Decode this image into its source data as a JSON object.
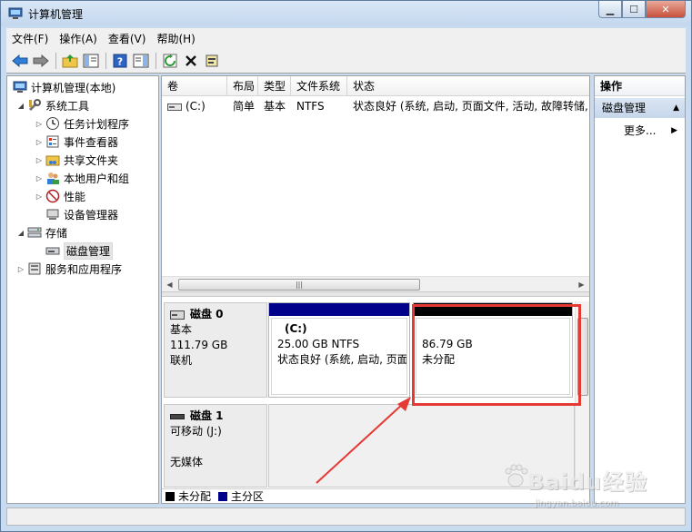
{
  "window": {
    "title": "计算机管理"
  },
  "menu": [
    "文件(F)",
    "操作(A)",
    "查看(V)",
    "帮助(H)"
  ],
  "toolbar": [
    "back-icon",
    "forward-icon",
    "up-folder-icon",
    "show-tree-icon",
    "help-icon",
    "show-action-pane-icon",
    "refresh-icon",
    "delete-icon",
    "properties-icon"
  ],
  "tree": {
    "root": "计算机管理(本地)",
    "system_tools": "系统工具",
    "task_scheduler": "任务计划程序",
    "event_viewer": "事件查看器",
    "shared_folders": "共享文件夹",
    "local_users": "本地用户和组",
    "performance": "性能",
    "device_manager": "设备管理器",
    "storage": "存储",
    "disk_management": "磁盘管理",
    "services_apps": "服务和应用程序"
  },
  "volume_list": {
    "columns": [
      "卷",
      "布局",
      "类型",
      "文件系统",
      "状态"
    ],
    "rows": [
      {
        "volume": "(C:)",
        "layout": "简单",
        "type": "基本",
        "fs": "NTFS",
        "status": "状态良好 (系统, 启动, 页面文件, 活动, 故障转储, 主"
      }
    ]
  },
  "disks": [
    {
      "name": "磁盘 0",
      "type": "基本",
      "size": "111.79 GB",
      "state": "联机",
      "partitions": [
        {
          "label": "(C:)",
          "size": "25.00 GB NTFS",
          "status": "状态良好 (系统, 启动, 页面",
          "kind": "primary"
        },
        {
          "label": "",
          "size": "86.79 GB",
          "status": "未分配",
          "kind": "unallocated"
        }
      ]
    },
    {
      "name": "磁盘 1",
      "type": "可移动 (J:)",
      "media": "无媒体"
    }
  ],
  "legend": [
    {
      "label": "未分配",
      "color": "#000000"
    },
    {
      "label": "主分区",
      "color": "#00008b"
    }
  ],
  "actions": {
    "title": "操作",
    "section": "磁盘管理",
    "more": "更多..."
  },
  "watermark": {
    "text": "Baidu经验",
    "sub": "jingyan.baidu.com"
  },
  "colors": {
    "primary_partition": "#00008b",
    "unallocated": "#000000",
    "annotation": "#e53935"
  }
}
